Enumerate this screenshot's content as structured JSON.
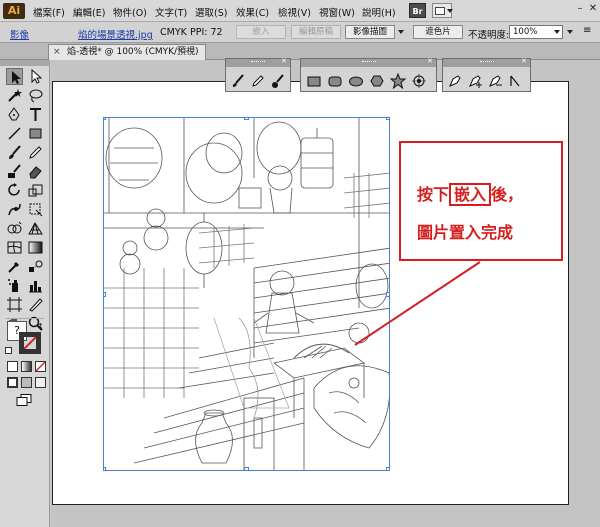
{
  "menubar": {
    "logo": "Ai",
    "items": [
      "檔案(F)",
      "編輯(E)",
      "物件(O)",
      "文字(T)",
      "選取(S)",
      "效果(C)",
      "檢視(V)",
      "視窗(W)",
      "說明(H)"
    ],
    "bridge_label": "Br"
  },
  "controlbar": {
    "object_type": "影像",
    "filename": "焰的場景透視.jpg",
    "color_mode": "CMYK",
    "ppi": "PPI: 72",
    "embed_button": "嵌入",
    "edit_original_button": "編輯原稿",
    "image_trace_button": "影像描圖",
    "mask_button": "遮色片",
    "opacity_label": "不透明度:",
    "opacity_value": "100%"
  },
  "document_tab": {
    "close": "×",
    "title": "焰-透視* @ 100% (CMYK/預視)"
  },
  "annotation": {
    "line1_prefix": "按下",
    "line1_highlight": "嵌入",
    "line1_suffix": "後，",
    "line2": "圖片置入完成",
    "color": "#d61e1e"
  },
  "colors": {
    "selection_blue": "#4a7fd8",
    "annotation_red": "#d61e1e"
  }
}
